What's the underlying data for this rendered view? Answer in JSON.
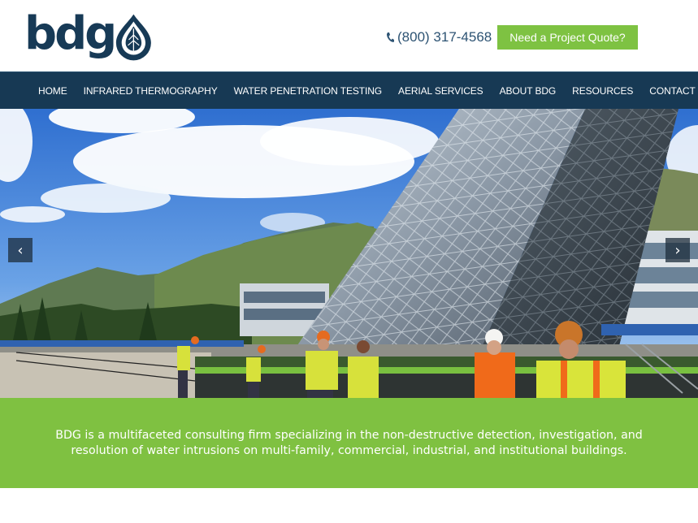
{
  "brand": {
    "logo_text": "bdg"
  },
  "header": {
    "phone": "(800) 317-4568",
    "quote_button": "Need a Project Quote?"
  },
  "nav": {
    "items": [
      {
        "label": "HOME"
      },
      {
        "label": "INFRARED THERMOGRAPHY"
      },
      {
        "label": "WATER PENETRATION TESTING"
      },
      {
        "label": "AERIAL SERVICES"
      },
      {
        "label": "ABOUT BDG"
      },
      {
        "label": "RESOURCES"
      },
      {
        "label": "CONTACT US"
      }
    ]
  },
  "hero": {
    "prev_glyph": "‹",
    "next_glyph": "›"
  },
  "banner": {
    "text": "BDG is a multifaceted consulting firm specializing in the non-destructive detection, investigation, and resolution of water intrusions on multi-family, commercial, industrial, and institutional buildings."
  },
  "colors": {
    "navy": "#173954",
    "green": "#7fc141",
    "phone": "#2d5373"
  },
  "icons": {
    "phone": "phone-icon",
    "logo_mark": "leaf-drop-icon",
    "prev": "chevron-left-icon",
    "next": "chevron-right-icon"
  }
}
